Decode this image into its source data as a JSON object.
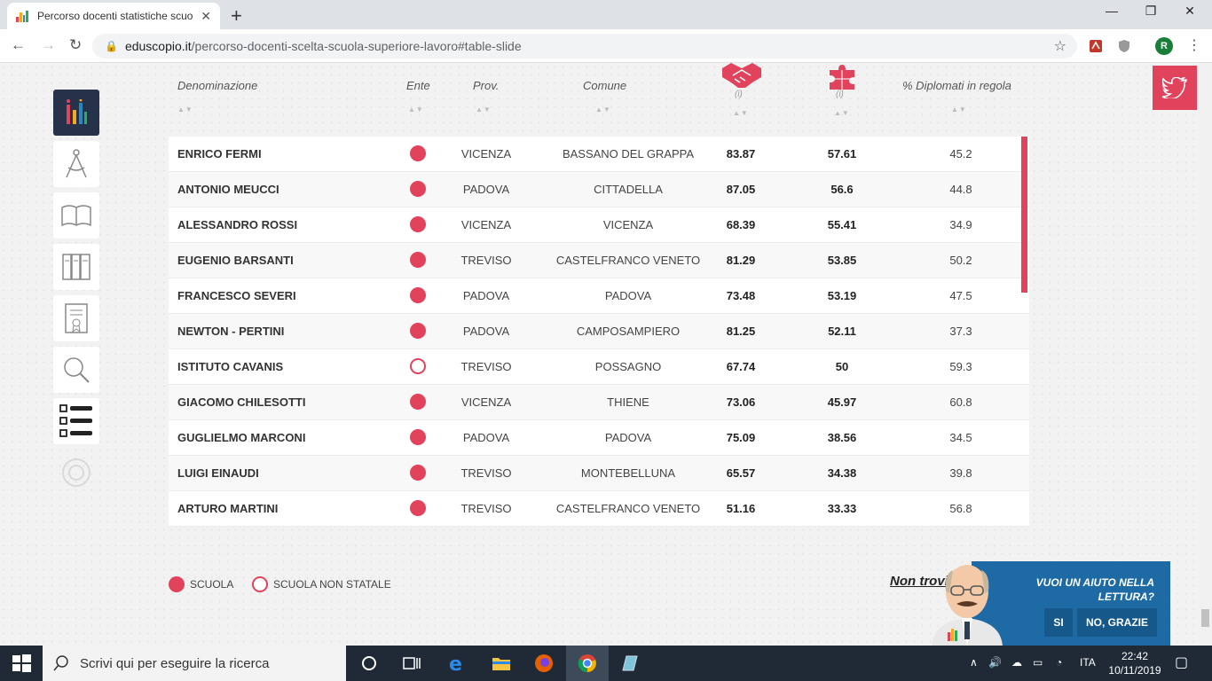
{
  "browser": {
    "tab_title": "Percorso docenti statistiche scuo",
    "tab_close": "✕",
    "new_tab": "+",
    "url_host": "eduscopio.it",
    "url_path": "/percorso-docenti-scelta-scuola-superiore-lavoro#table-slide",
    "profile_initial": "R",
    "controls": {
      "minimize": "—",
      "restore": "❐",
      "close": "✕"
    }
  },
  "table": {
    "headers": {
      "denominazione": "Denominazione",
      "ente": "Ente",
      "prov": "Prov.",
      "comune": "Comune",
      "diplomati": "% Diplomati in regola",
      "info1": "(i)",
      "info2": "(i)"
    },
    "rows": [
      {
        "name": "ENRICO FERMI",
        "ente": "scuola",
        "prov": "VICENZA",
        "comune": "BASSANO DEL GRAPPA",
        "v1": "83.87",
        "v2": "57.61",
        "v3": "45.2"
      },
      {
        "name": "ANTONIO MEUCCI",
        "ente": "scuola",
        "prov": "PADOVA",
        "comune": "CITTADELLA",
        "v1": "87.05",
        "v2": "56.6",
        "v3": "44.8"
      },
      {
        "name": "ALESSANDRO ROSSI",
        "ente": "scuola",
        "prov": "VICENZA",
        "comune": "VICENZA",
        "v1": "68.39",
        "v2": "55.41",
        "v3": "34.9"
      },
      {
        "name": "EUGENIO BARSANTI",
        "ente": "scuola",
        "prov": "TREVISO",
        "comune": "CASTELFRANCO VENETO",
        "v1": "81.29",
        "v2": "53.85",
        "v3": "50.2"
      },
      {
        "name": "FRANCESCO SEVERI",
        "ente": "scuola",
        "prov": "PADOVA",
        "comune": "PADOVA",
        "v1": "73.48",
        "v2": "53.19",
        "v3": "47.5"
      },
      {
        "name": "NEWTON - PERTINI",
        "ente": "scuola",
        "prov": "PADOVA",
        "comune": "CAMPOSAMPIERO",
        "v1": "81.25",
        "v2": "52.11",
        "v3": "37.3"
      },
      {
        "name": "ISTITUTO CAVANIS",
        "ente": "non-statale",
        "prov": "TREVISO",
        "comune": "POSSAGNO",
        "v1": "67.74",
        "v2": "50",
        "v3": "59.3"
      },
      {
        "name": "GIACOMO CHILESOTTI",
        "ente": "scuola",
        "prov": "VICENZA",
        "comune": "THIENE",
        "v1": "73.06",
        "v2": "45.97",
        "v3": "60.8"
      },
      {
        "name": "GUGLIELMO MARCONI",
        "ente": "scuola",
        "prov": "PADOVA",
        "comune": "PADOVA",
        "v1": "75.09",
        "v2": "38.56",
        "v3": "34.5"
      },
      {
        "name": "LUIGI EINAUDI",
        "ente": "scuola",
        "prov": "TREVISO",
        "comune": "MONTEBELLUNA",
        "v1": "65.57",
        "v2": "34.38",
        "v3": "39.8"
      },
      {
        "name": "ARTURO MARTINI",
        "ente": "scuola",
        "prov": "TREVISO",
        "comune": "CASTELFRANCO VENETO",
        "v1": "51.16",
        "v2": "33.33",
        "v3": "56.8"
      }
    ]
  },
  "legend": {
    "scuola": "SCUOLA",
    "non_statale": "SCUOLA NON STATALE"
  },
  "helper": {
    "link": "Non trovi",
    "question_line1": "VUOI UN AIUTO NELLA",
    "question_line2": "LETTURA?",
    "yes": "SI",
    "no": "NO, GRAZIE"
  },
  "taskbar": {
    "search_placeholder": "Scrivi qui per eseguire la ricerca",
    "language": "ITA",
    "time": "22:42",
    "date": "10/11/2019"
  },
  "colors": {
    "accent": "#e0435b",
    "sidebar_active": "#26324a",
    "helper_bg": "#1d6aa5"
  }
}
